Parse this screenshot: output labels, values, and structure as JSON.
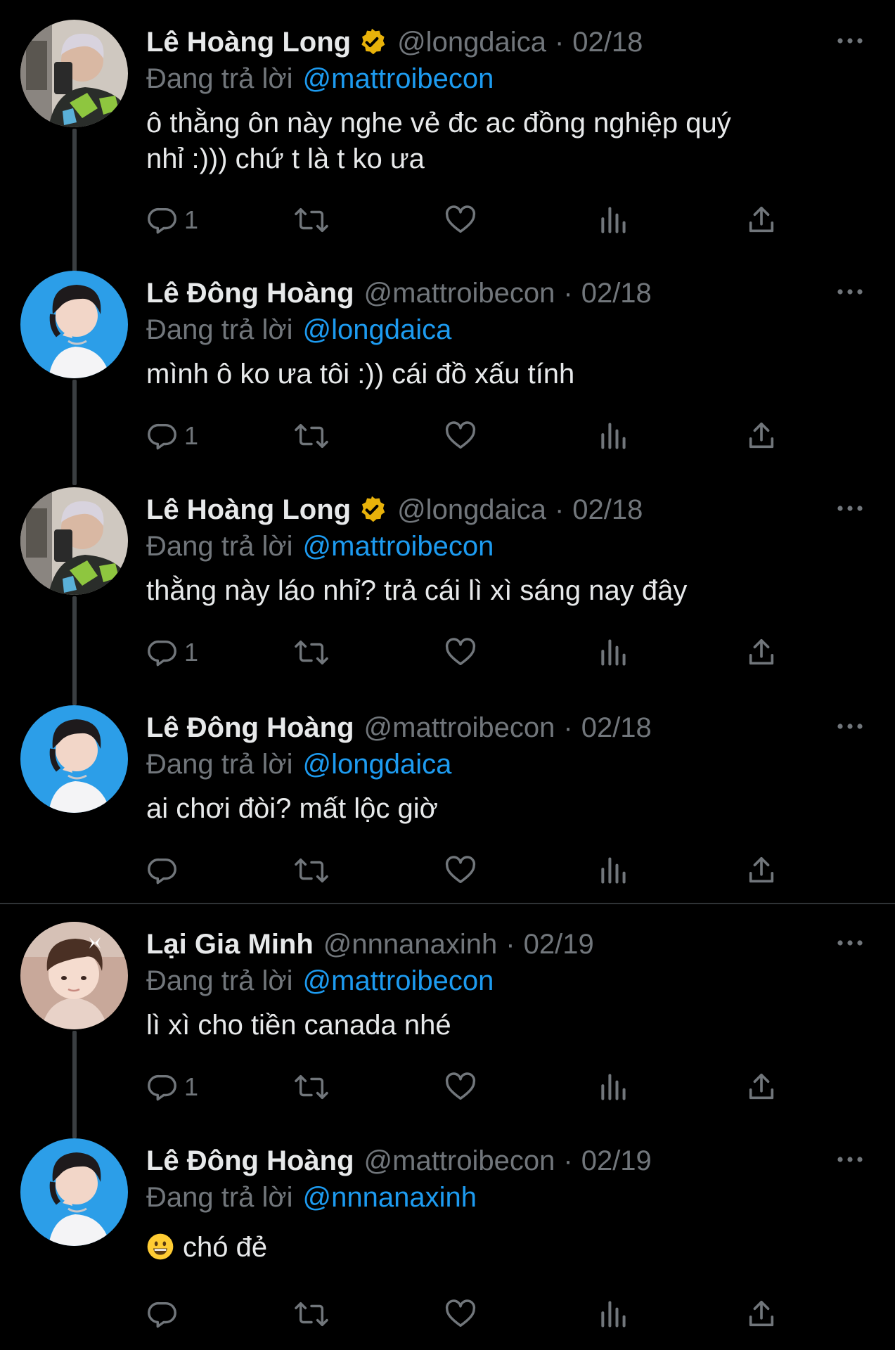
{
  "labels": {
    "replying_to": "Đang trả lời",
    "dot": "·"
  },
  "colors": {
    "background": "#000000",
    "text": "#e7e9ea",
    "secondary": "#71767b",
    "link": "#1d9bf0",
    "verified": "#e8b20a",
    "thread_line": "#3a3e41"
  },
  "tweets": [
    {
      "name": "Lê Hoàng Long",
      "verified": true,
      "handle": "@longdaica",
      "date": "02/18",
      "replying_to": "@mattroibecon",
      "text_line1": "ô thằng ôn này nghe vẻ đc ac đồng nghiệp quý",
      "text_line2": "nhỉ :))) chứ t là t ko ưa",
      "reply_count": "1",
      "avatar": "avatar-long"
    },
    {
      "name": "Lê Đông Hoàng",
      "verified": false,
      "handle": "@mattroibecon",
      "date": "02/18",
      "replying_to": "@longdaica",
      "text_line1": "mình ô ko ưa tôi :)) cái đồ xấu tính",
      "reply_count": "1",
      "avatar": "avatar-hoang"
    },
    {
      "name": "Lê Hoàng Long",
      "verified": true,
      "handle": "@longdaica",
      "date": "02/18",
      "replying_to": "@mattroibecon",
      "text_line1": "thằng này láo nhỉ? trả cái lì xì sáng nay đây",
      "reply_count": "1",
      "avatar": "avatar-long"
    },
    {
      "name": "Lê Đông Hoàng",
      "verified": false,
      "handle": "@mattroibecon",
      "date": "02/18",
      "replying_to": "@longdaica",
      "text_line1": "ai chơi đòi? mất lộc giờ",
      "reply_count": "",
      "avatar": "avatar-hoang"
    },
    {
      "name": "Lại Gia Minh",
      "verified": false,
      "handle": "@nnnanaxinh",
      "date": "02/19",
      "replying_to": "@mattroibecon",
      "text_line1": "lì xì cho tiền canada nhé",
      "reply_count": "1",
      "avatar": "avatar-minh"
    },
    {
      "name": "Lê Đông Hoàng",
      "verified": false,
      "handle": "@mattroibecon",
      "date": "02/19",
      "replying_to": "@nnnanaxinh",
      "text_line1": "chó đẻ",
      "emoji": "grinning-face-emoji",
      "reply_count": "",
      "avatar": "avatar-hoang"
    }
  ],
  "icons": {
    "reply": "reply-icon",
    "retweet": "retweet-icon",
    "like": "heart-icon",
    "views": "views-icon",
    "share": "share-icon",
    "more": "more-icon",
    "verified": "verified-badge-icon"
  }
}
